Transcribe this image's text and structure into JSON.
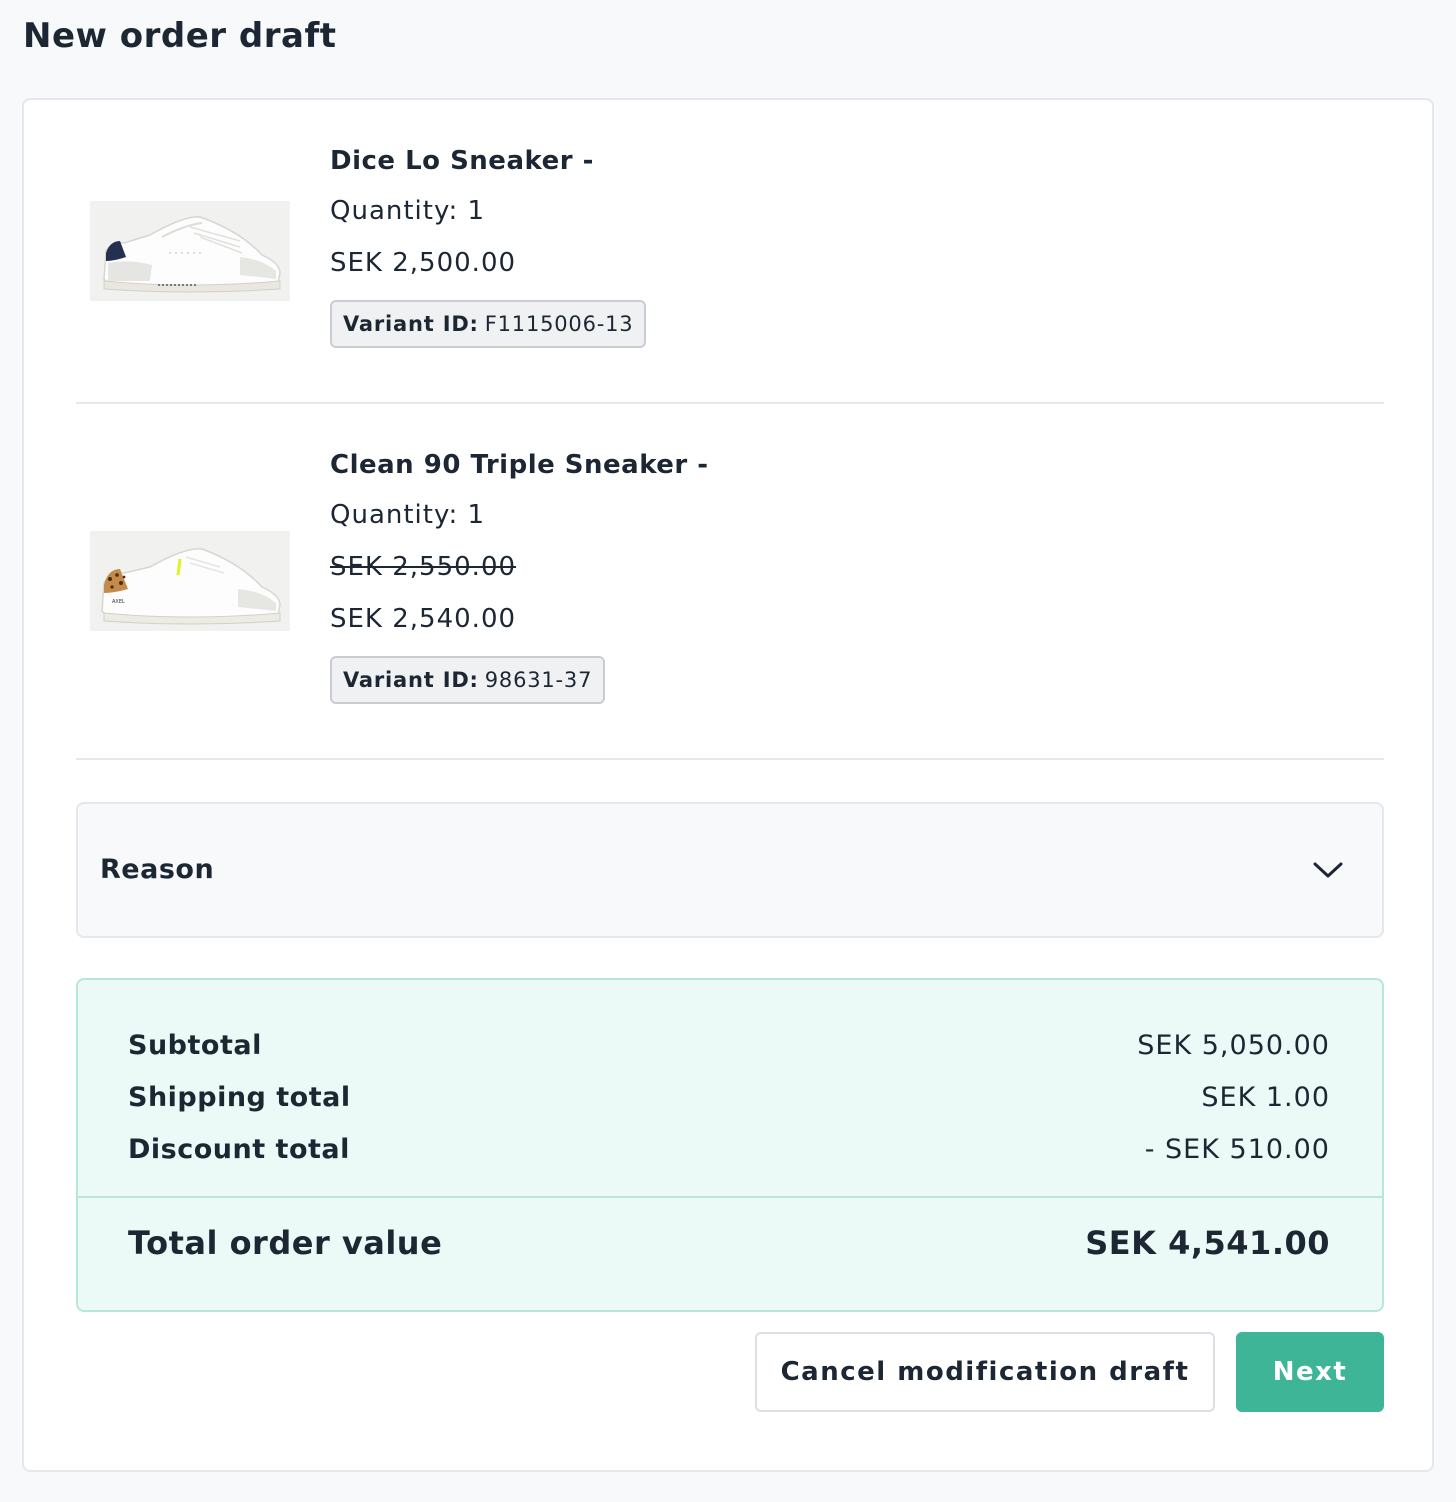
{
  "page": {
    "title": "New order draft"
  },
  "items": [
    {
      "name": "Dice Lo Sneaker -",
      "quantity": "Quantity: 1",
      "price": "SEK 2,500.00",
      "variant_label": "Variant ID:",
      "variant_id": "F1115006-13",
      "image_icon": "sneaker-navy-heel-image"
    },
    {
      "name": "Clean 90 Triple Sneaker -",
      "quantity": "Quantity: 1",
      "original_price": "SEK 2,550.00",
      "price": "SEK 2,540.00",
      "variant_label": "Variant ID:",
      "variant_id": "98631-37",
      "image_icon": "sneaker-leopard-heel-image"
    }
  ],
  "reason": {
    "label": "Reason",
    "icon": "chevron-down-icon"
  },
  "summary": {
    "subtotal_label": "Subtotal",
    "subtotal_value": "SEK 5,050.00",
    "shipping_label": "Shipping total",
    "shipping_value": "SEK 1.00",
    "discount_label": "Discount total",
    "discount_value": "- SEK 510.00",
    "total_label": "Total order value",
    "total_value": "SEK 4,541.00"
  },
  "actions": {
    "cancel_label": "Cancel modification draft",
    "next_label": "Next"
  },
  "colors": {
    "accent": "#3fb597",
    "summary_bg": "#ebfaf6",
    "text": "#1c2733"
  }
}
